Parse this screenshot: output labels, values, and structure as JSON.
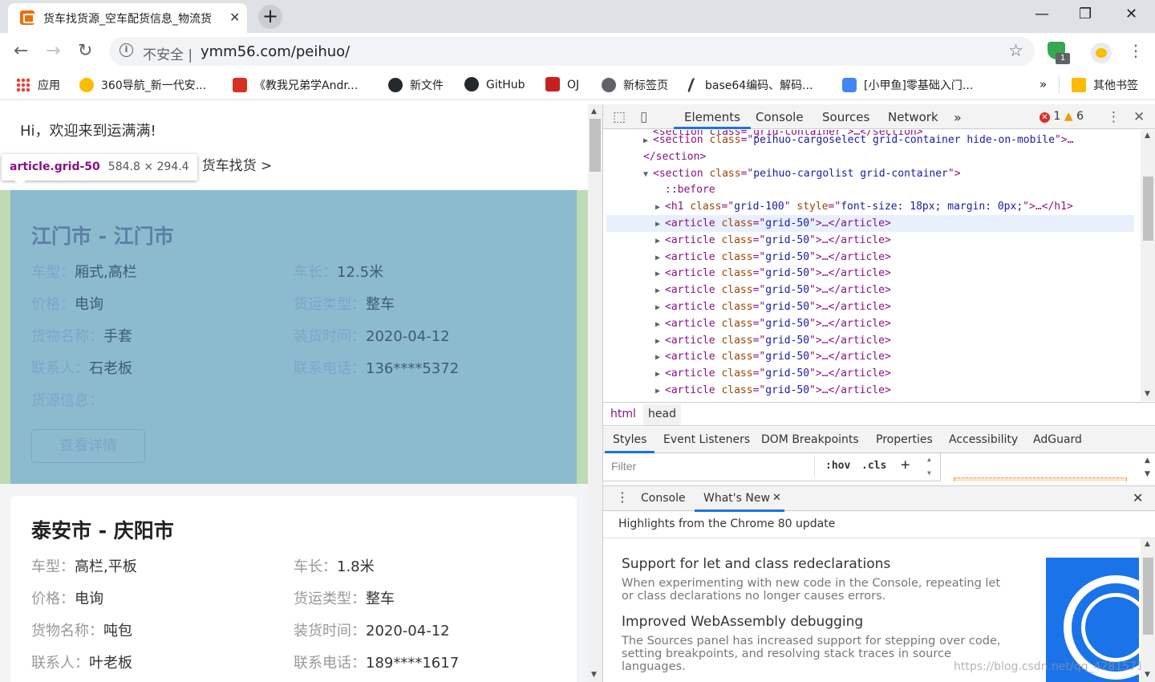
{
  "browser": {
    "tab_title": "货车找货源_空车配货信息_物流货",
    "address": {
      "security_label": "不安全",
      "separator": "|",
      "url": "ymm56.com/peihuo/"
    },
    "ext_badge": "1",
    "bookmarks": [
      {
        "label": "应用",
        "icon": "apps-grid-icon"
      },
      {
        "label": "360导航_新一代安...",
        "icon": "360-icon"
      },
      {
        "label": "《教我兄弟学Andr...",
        "icon": "book-icon"
      },
      {
        "label": "新文件",
        "icon": "github-icon"
      },
      {
        "label": "GitHub",
        "icon": "github-icon"
      },
      {
        "label": "OJ",
        "icon": "oj-icon"
      },
      {
        "label": "新标签页",
        "icon": "globe-icon"
      },
      {
        "label": "base64编码、解码...",
        "icon": "v-icon"
      },
      {
        "label": "[小甲鱼]零基础入门...",
        "icon": "tv-icon"
      }
    ],
    "overflow_chevron": "»",
    "other_bookmarks": "其他书签"
  },
  "page": {
    "greeting": "Hi，欢迎来到运满满!",
    "breadcrumb": "> 货车找货 >",
    "tooltip": {
      "name": "article.grid-50",
      "size": "584.8 × 294.4"
    },
    "cards": [
      {
        "title": "江门市 - 江门市",
        "fields": [
          {
            "k": "车型：",
            "v": "厢式,高栏"
          },
          {
            "k": "车长：",
            "v": "12.5米"
          },
          {
            "k": "价格：",
            "v": "电询"
          },
          {
            "k": "货运类型：",
            "v": "整车"
          },
          {
            "k": "货物名称：",
            "v": "手套"
          },
          {
            "k": "装货时间：",
            "v": "2020-04-12"
          },
          {
            "k": "联系人：",
            "v": "石老板"
          },
          {
            "k": "联系电话：",
            "v": "136****5372"
          },
          {
            "k": "货源信息：",
            "v": ""
          }
        ],
        "button": "查看详情"
      },
      {
        "title": "泰安市 - 庆阳市",
        "fields": [
          {
            "k": "车型：",
            "v": "高栏,平板"
          },
          {
            "k": "车长：",
            "v": "1.8米"
          },
          {
            "k": "价格：",
            "v": "电询"
          },
          {
            "k": "货运类型：",
            "v": "整车"
          },
          {
            "k": "货物名称：",
            "v": "吨包"
          },
          {
            "k": "装货时间：",
            "v": "2020-04-12"
          },
          {
            "k": "联系人：",
            "v": "叶老板"
          },
          {
            "k": "联系电话：",
            "v": "189****1617"
          }
        ]
      }
    ]
  },
  "devtools": {
    "tabs": [
      "Elements",
      "Console",
      "Sources",
      "Network"
    ],
    "more_tabs": "»",
    "errors": "1",
    "warnings": "6",
    "dom_lines": [
      {
        "kind": "open_close_partial",
        "text": "<section class=\"grid-container\">…</section>"
      },
      {
        "kind": "section",
        "tri": "▶",
        "tag": "section",
        "attr": "class",
        "val": "peihuo-cargoselect grid-container hide-on-mobile",
        "tail": ">…"
      },
      {
        "kind": "closing",
        "text": "</section>"
      },
      {
        "kind": "section",
        "tri": "▼",
        "tag": "section",
        "attr": "class",
        "val": "peihuo-cargolist grid-container",
        "tail": ">"
      },
      {
        "kind": "pseudo",
        "text": "::before"
      },
      {
        "kind": "h1",
        "tri": "▶",
        "tag": "h1",
        "attr": "class",
        "val": "grid-100",
        "attr2": "style",
        "val2": "font-size: 18px; margin: 0px;",
        "tail": ">…</h1>"
      },
      {
        "kind": "article",
        "tri": "▶",
        "tag": "article",
        "attr": "class",
        "val": "grid-50",
        "tail": ">…</article>"
      }
    ],
    "article_repeat": 11,
    "breadcrumbs": [
      "html",
      "head"
    ],
    "sub_tabs": [
      "Styles",
      "Event Listeners",
      "DOM Breakpoints",
      "Properties",
      "Accessibility",
      "AdGuard"
    ],
    "filter_placeholder": "Filter",
    "hov": ":hov",
    "cls": ".cls",
    "drawer_tabs": [
      "Console",
      "What's New"
    ],
    "whats_new": {
      "header": "Highlights from the Chrome 80 update",
      "items": [
        {
          "title": "Support for let and class redeclarations",
          "desc": "When experimenting with new code in the Console, repeating let or class declarations no longer causes errors."
        },
        {
          "title": "Improved WebAssembly debugging",
          "desc": "The Sources panel has increased support for stepping over code, setting breakpoints, and resolving stack traces in source languages."
        }
      ]
    },
    "watermark": "https://blog.csdn.net/qq_42815711"
  }
}
